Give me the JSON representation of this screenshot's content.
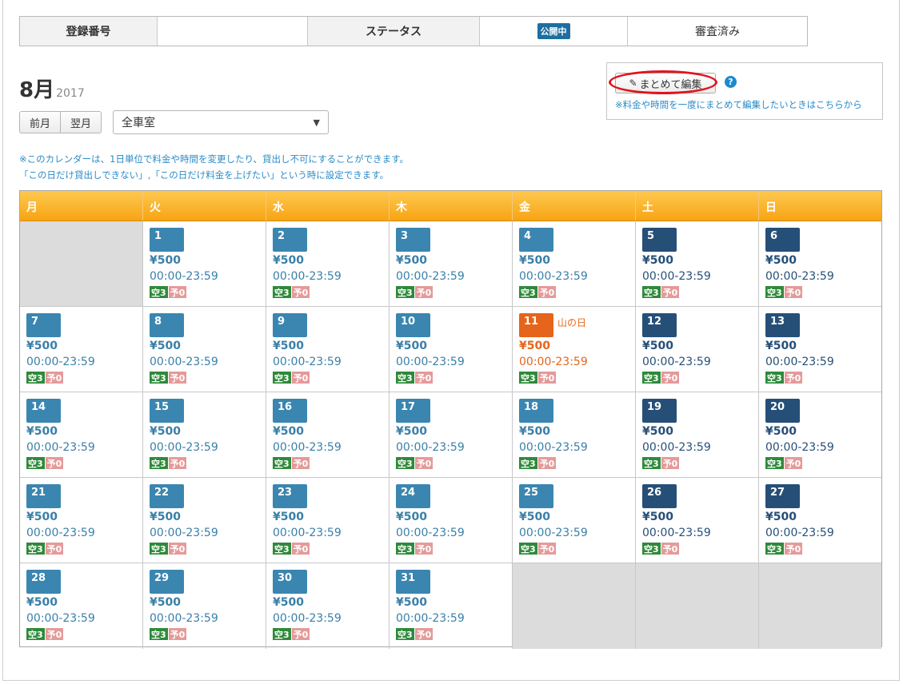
{
  "info": {
    "reg_label": "登録番号",
    "reg_value": "",
    "status_label": "ステータス",
    "status_badge": "公開中",
    "review_status": "審査済み"
  },
  "month": {
    "title": "8月",
    "year": "2017"
  },
  "nav": {
    "prev": "前月",
    "next": "翌月"
  },
  "room_select": {
    "selected": "全車室"
  },
  "bulk": {
    "button": "まとめて編集",
    "help": "?",
    "note": "※料金や時間を一度にまとめて編集したいときはこちらから"
  },
  "notes": [
    "※このカレンダーは、1日単位で料金や時間を変更したり、貸出し不可にすることができます。",
    "「この日だけ貸出しできない」,「この日だけ料金を上げたい」という時に設定できます。"
  ],
  "colors": {
    "weekday": "#3a86b0",
    "weekend": "#264f78",
    "holiday": "#e5651a",
    "text_weekday": "#3a7fa8",
    "text_weekend": "#264f78"
  },
  "weekdays": [
    "月",
    "火",
    "水",
    "木",
    "金",
    "土",
    "日"
  ],
  "tag_vacant": "空3",
  "tag_reserved": "予0",
  "price": "¥500",
  "time": "00:00-23:59",
  "holiday_11": "山の日"
}
